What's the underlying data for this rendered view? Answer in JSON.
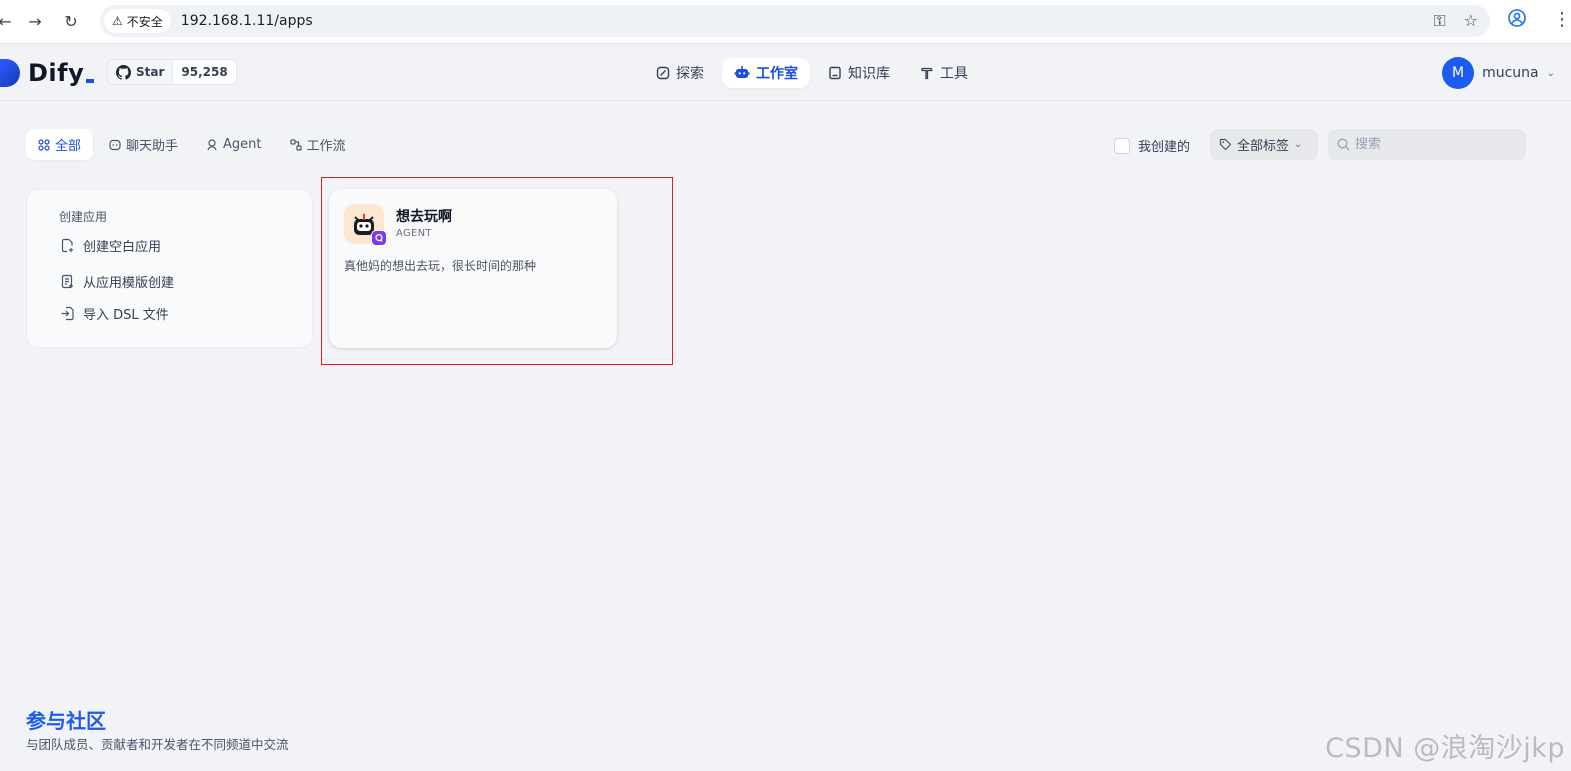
{
  "browser": {
    "security_label": "不安全",
    "url": "192.168.1.11/apps"
  },
  "header": {
    "logo_text": "Dify",
    "github": {
      "star_label": "Star",
      "star_count": "95,258"
    },
    "nav": [
      {
        "label": "探索",
        "icon": "explore-icon",
        "active": false
      },
      {
        "label": "工作室",
        "icon": "robot-icon",
        "active": true
      },
      {
        "label": "知识库",
        "icon": "book-icon",
        "active": false
      },
      {
        "label": "工具",
        "icon": "hammer-icon",
        "active": false
      }
    ],
    "user": {
      "avatar_letter": "M",
      "name": "mucuna"
    }
  },
  "filters": {
    "tabs": [
      {
        "label": "全部",
        "icon": "grid-icon",
        "active": true
      },
      {
        "label": "聊天助手",
        "icon": "chat-icon",
        "active": false
      },
      {
        "label": "Agent",
        "icon": "agent-icon",
        "active": false
      },
      {
        "label": "工作流",
        "icon": "workflow-icon",
        "active": false
      }
    ],
    "mine_label": "我创建的",
    "tags_label": "全部标签",
    "search_placeholder": "搜索"
  },
  "create": {
    "title": "创建应用",
    "items": [
      {
        "label": "创建空白应用",
        "icon": "file-plus-icon"
      },
      {
        "label": "从应用模版创建",
        "icon": "template-icon"
      },
      {
        "label": "导入 DSL 文件",
        "icon": "import-icon"
      }
    ]
  },
  "apps": [
    {
      "name": "想去玩啊",
      "type": "AGENT",
      "description": "真他妈的想出去玩，很长时间的那种"
    }
  ],
  "footer": {
    "title": "参与社区",
    "subtitle": "与团队成员、贡献者和开发者在不同频道中交流"
  },
  "watermark": "CSDN @浪淘沙jkp",
  "colors": {
    "accent": "#1d4ed8",
    "avatar": "#1d5bf0",
    "highlight": "#e02020",
    "badge": "#7c3aed"
  }
}
